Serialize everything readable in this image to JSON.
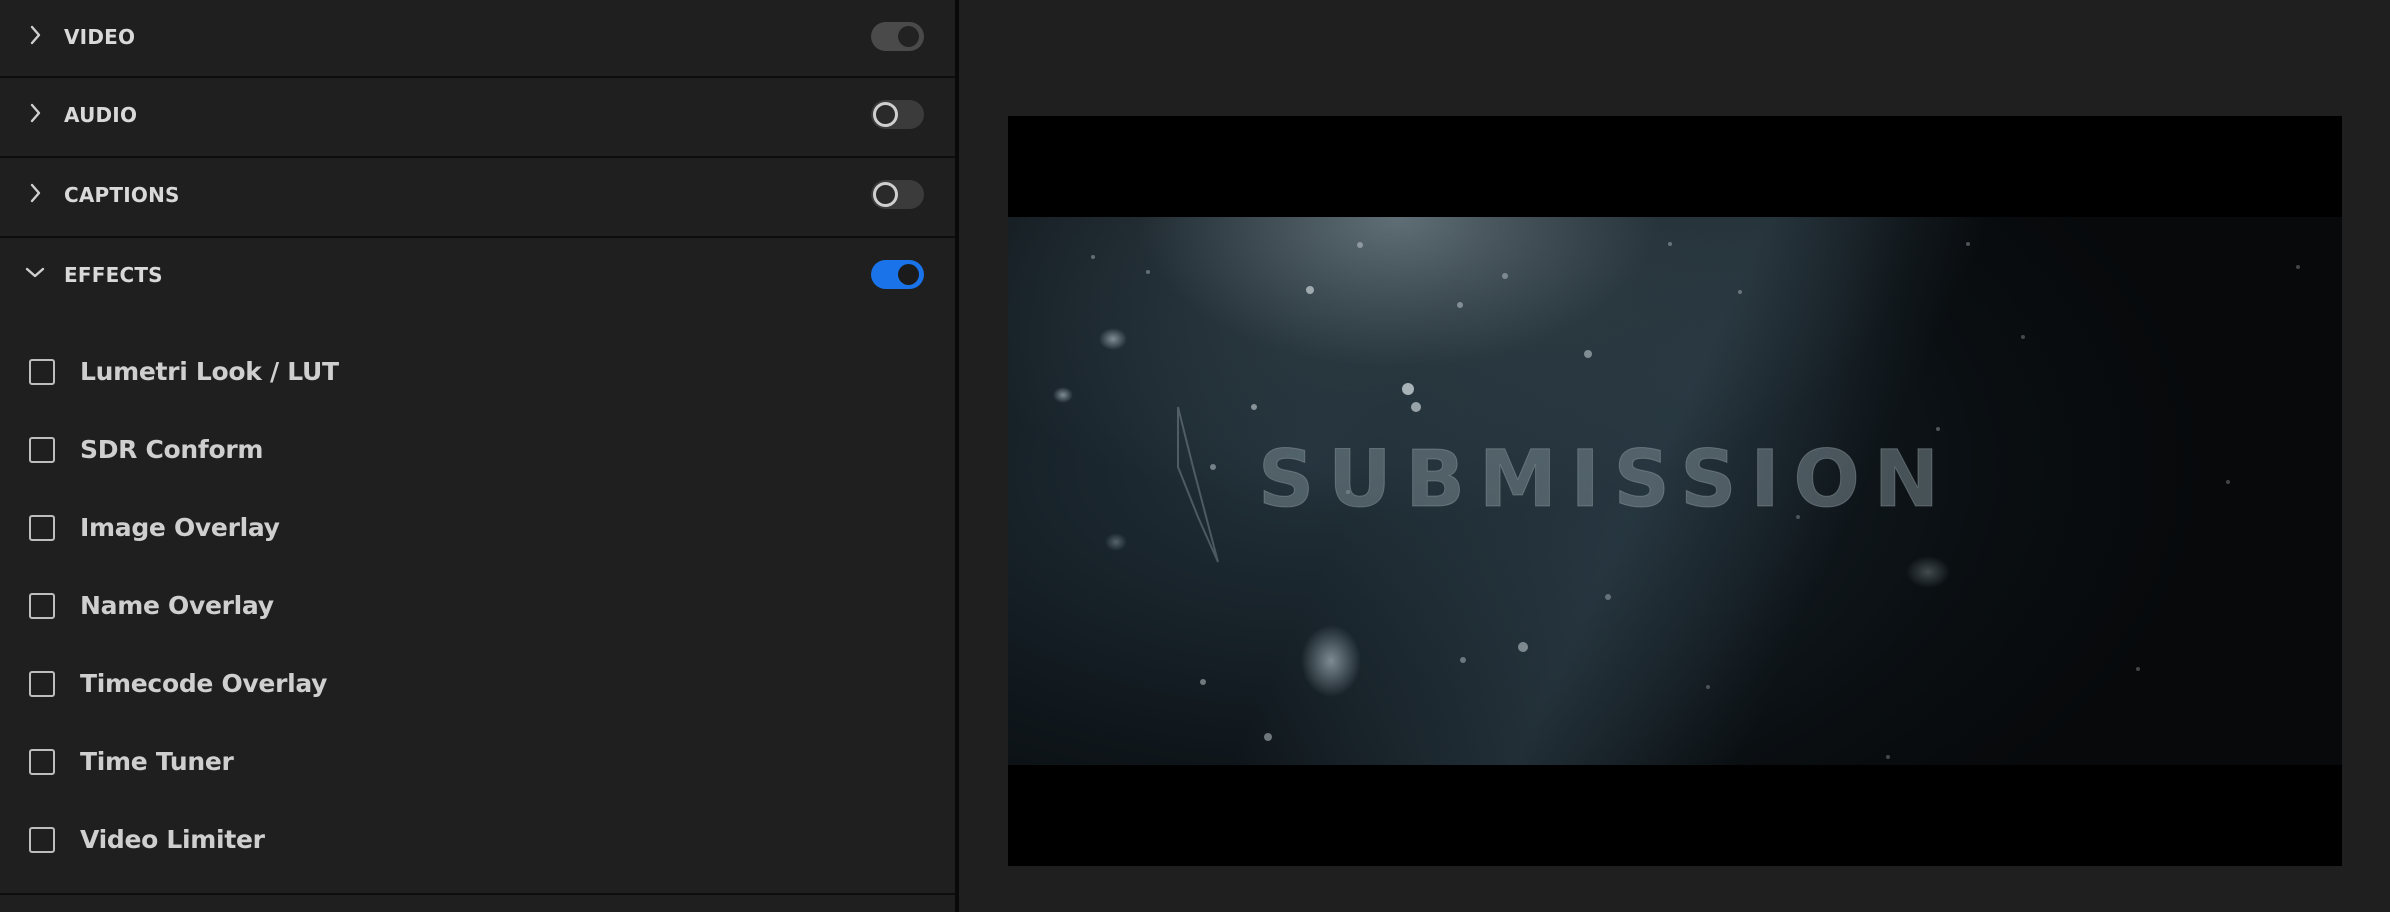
{
  "sections": [
    {
      "key": "video",
      "label": "VIDEO",
      "expanded": false,
      "toggle": "on-gray"
    },
    {
      "key": "audio",
      "label": "AUDIO",
      "expanded": false,
      "toggle": "off"
    },
    {
      "key": "captions",
      "label": "CAPTIONS",
      "expanded": false,
      "toggle": "off"
    },
    {
      "key": "effects",
      "label": "EFFECTS",
      "expanded": true,
      "toggle": "on-blue"
    }
  ],
  "effects": [
    {
      "label": "Lumetri Look / LUT",
      "checked": false
    },
    {
      "label": "SDR Conform",
      "checked": false
    },
    {
      "label": "Image Overlay",
      "checked": false
    },
    {
      "label": "Name Overlay",
      "checked": false
    },
    {
      "label": "Timecode Overlay",
      "checked": false
    },
    {
      "label": "Time Tuner",
      "checked": false
    },
    {
      "label": "Video Limiter",
      "checked": false
    }
  ],
  "preview": {
    "title_text": "SUBMISSION"
  },
  "colors": {
    "panel_bg": "#1f1f1f",
    "accent_blue": "#1a73e8",
    "text": "#d9d9d9"
  }
}
